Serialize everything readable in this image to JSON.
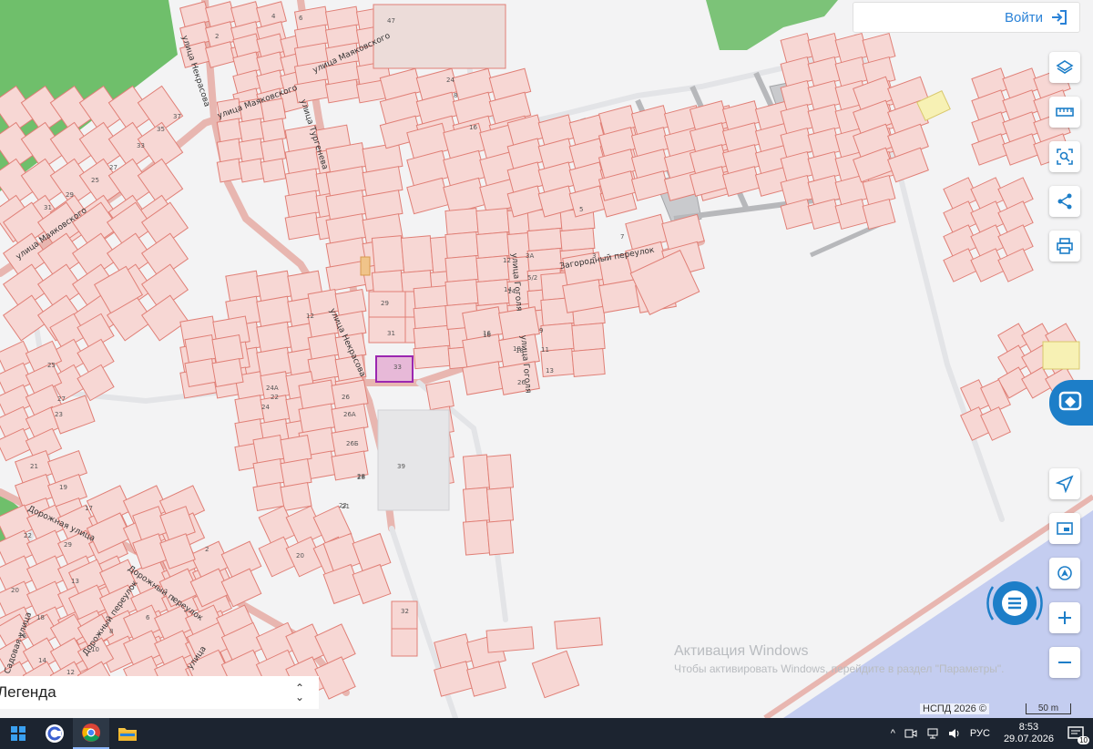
{
  "header": {
    "login_label": "Войти"
  },
  "map": {
    "streets": [
      "улица Некрасова",
      "улица Маяковского",
      "улица Маяковского",
      "улица Маяковского",
      "улица Тургенева",
      "Загородный переулок",
      "улица Гоголя",
      "улица Гоголя",
      "улица Некрасова",
      "Дорожная улица",
      "Дорожный переулок",
      "Дорожный переулок",
      "Садовая улица",
      "улица"
    ],
    "house_numbers": [
      "47",
      "4",
      "6",
      "2",
      "24",
      "8",
      "16",
      "33",
      "29",
      "31",
      "26",
      "26А",
      "26Б",
      "28",
      "22",
      "24А",
      "24",
      "39",
      "12",
      "18",
      "14",
      "16",
      "3",
      "5",
      "7",
      "9",
      "11",
      "13",
      "5/2",
      "3А",
      "12",
      "14",
      "16",
      "18",
      "26",
      "25",
      "27",
      "23",
      "21",
      "19",
      "17",
      "32",
      "20",
      "22",
      "28",
      "21",
      "13",
      "29",
      "2",
      "4",
      "6",
      "8",
      "10",
      "12",
      "14",
      "16",
      "18",
      "20",
      "22",
      "37",
      "35",
      "33",
      "27",
      "25",
      "29",
      "31"
    ]
  },
  "legend": {
    "label": "Легенда"
  },
  "watermark": {
    "title": "Активация Windows",
    "subtitle": "Чтобы активировать Windows, перейдите в раздел \"Параметры\"."
  },
  "footer": {
    "copyright": "НСПД 2026 ©",
    "scale_label": "50 m"
  },
  "taskbar": {
    "tray_lang": "РУС",
    "time": "8:53",
    "date": "29.07.2026",
    "notification_count": "10"
  },
  "colors": {
    "parcel_fill": "#f7d7d4",
    "parcel_stroke": "#e07f76",
    "selected_parcel": "#9b27b0",
    "forest": "#6fbf6b",
    "water": "#c4cdf0",
    "accent": "#1d7ec8"
  }
}
